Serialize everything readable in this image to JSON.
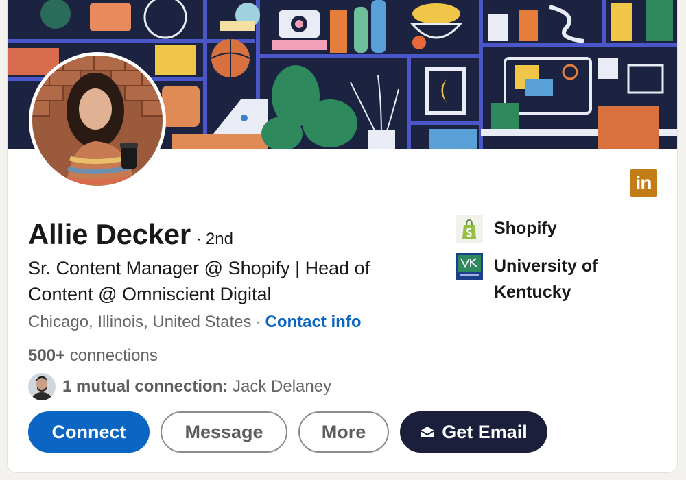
{
  "profile": {
    "name": "Allie Decker",
    "degree_sep": "·",
    "degree": "2nd",
    "headline": "Sr. Content Manager @ Shopify | Head of Content @ Omniscient Digital",
    "location": "Chicago, Illinois, United States",
    "location_sep": "·",
    "contact_link": "Contact info",
    "connections_count": "500+",
    "connections_label": " connections",
    "mutual_prefix": "1 mutual connection:",
    "mutual_name": " Jack Delaney"
  },
  "badges": {
    "linkedin_text": "in"
  },
  "experience": [
    {
      "label": "Shopify",
      "logo": "shopify-logo"
    },
    {
      "label": "University of Kentucky",
      "logo": "university-of-kentucky-logo"
    }
  ],
  "actions": {
    "connect": "Connect",
    "message": "Message",
    "more": "More",
    "get_email": "Get Email"
  },
  "colors": {
    "accent_blue": "#0a66c2",
    "email_button": "#1b1f3b",
    "linkedin_badge": "#c37d16",
    "banner_bg": "#1c2340"
  },
  "icons": [
    "linkedin-icon",
    "envelope-icon",
    "shopify-bag-icon"
  ]
}
